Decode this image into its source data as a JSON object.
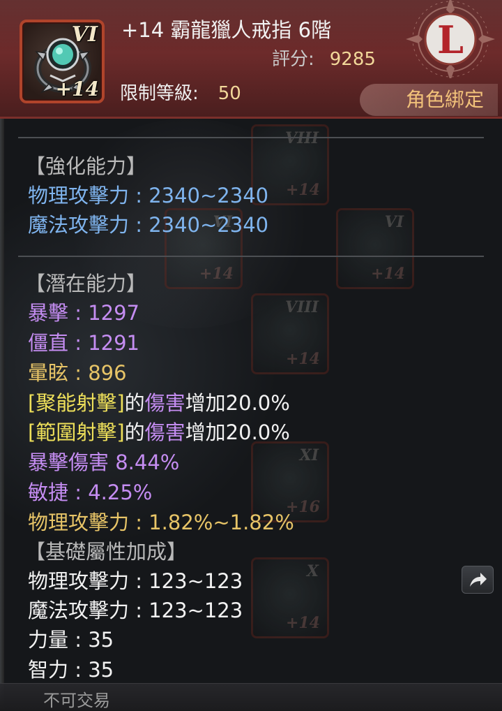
{
  "item": {
    "tier": "VI",
    "enhance": "+14",
    "name": "+14 霸龍獵人戒指 6階",
    "score_label": "評分:",
    "score_value": "9285",
    "level_label": "限制等級:",
    "level_value": "50",
    "rank": "L",
    "bind": "角色綁定"
  },
  "sections": {
    "enhance": {
      "title": "【強化能力】",
      "stats": [
        "物理攻擊力 : 2340~2340",
        "魔法攻擊力 : 2340~2340"
      ]
    },
    "potential": {
      "title": "【潛在能力】",
      "stats": [
        "暴擊 : 1297",
        "僵直 : 1291",
        "暈眩 : 896"
      ],
      "skill_lines": [
        {
          "skill": "[聚能射擊]",
          "of": "的",
          "target": "傷害",
          "effect": "增加20.0%"
        },
        {
          "skill": "[範圍射擊]",
          "of": "的",
          "target": "傷害",
          "effect": "增加20.0%"
        }
      ],
      "extra": [
        "暴擊傷害 8.44%",
        "敏捷 : 4.25%",
        "物理攻擊力 : 1.82%~1.82%"
      ]
    },
    "base": {
      "title": "【基礎屬性加成】",
      "stats": [
        "物理攻擊力 : 123~123",
        "魔法攻擊力 : 123~123",
        "力量 : 35",
        "智力 : 35"
      ]
    }
  },
  "footer": {
    "trade": "不可交易",
    "share_icon": "share-arrow-icon"
  },
  "background_slots": [
    {
      "tier": "VIII",
      "enhance": "+14"
    },
    {
      "tier": "VI",
      "enhance": "+14"
    },
    {
      "tier": "VI",
      "enhance": "+14"
    },
    {
      "tier": "VIII",
      "enhance": "+14"
    },
    {
      "tier": "XI",
      "enhance": "+16"
    },
    {
      "tier": "X",
      "enhance": "+14"
    }
  ],
  "colors": {
    "header_bg": "#5b2424",
    "frame_border": "#b0442b",
    "bind_text": "#f2c27a",
    "gold_value": "#f2d89a",
    "enhance_stat": "#7fb4ee",
    "potential_purple": "#c58df2",
    "potential_gold": "#e7c467",
    "skill_yellow": "#eee05a"
  }
}
